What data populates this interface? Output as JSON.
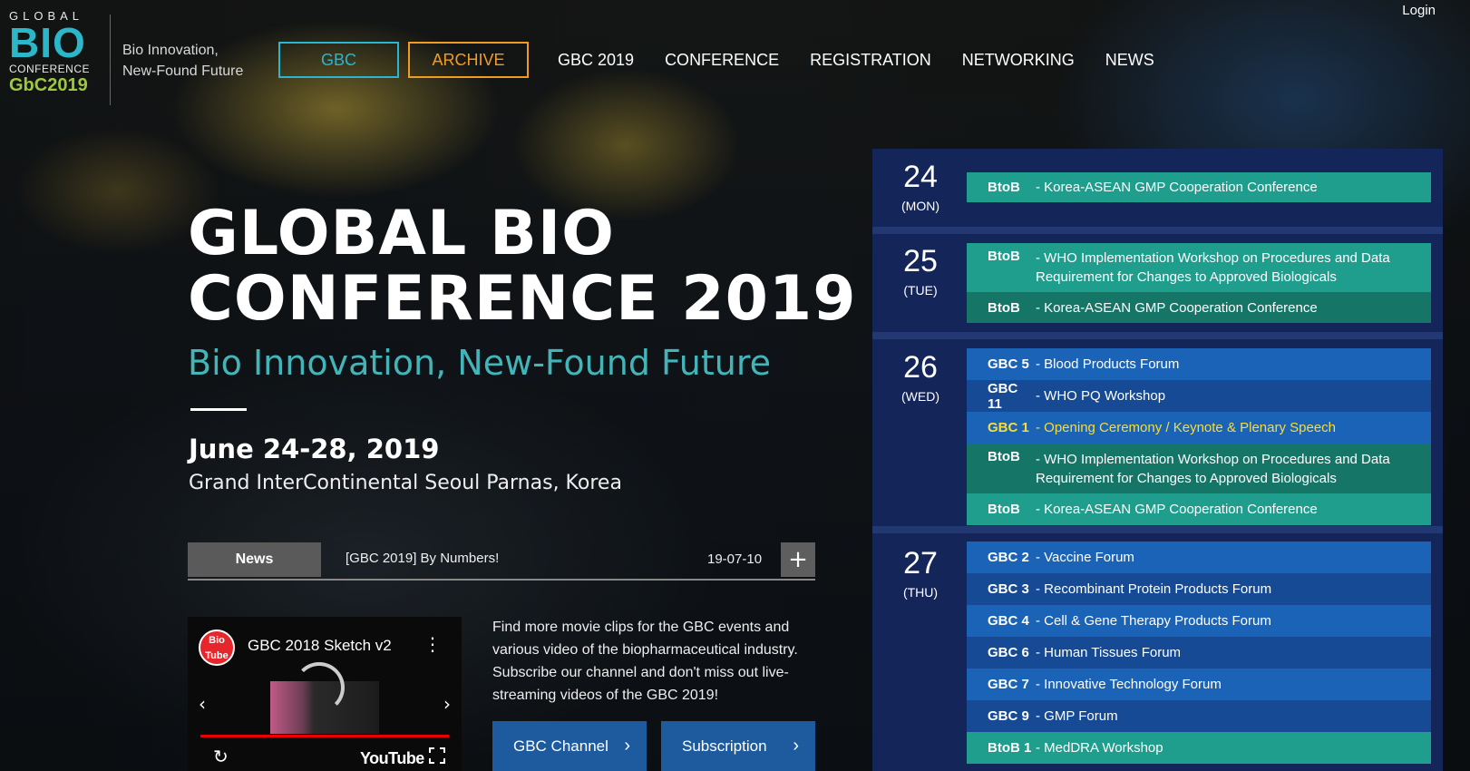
{
  "logo": {
    "global": "GLOBAL",
    "bio": "BIO",
    "conference": "CONFERENCE",
    "gbc": "GbC2019"
  },
  "tagline": {
    "line1": "Bio Innovation,",
    "line2": "New-Found Future"
  },
  "nav": {
    "gbc": "GBC",
    "archive": "ARCHIVE",
    "items": [
      "GBC 2019",
      "CONFERENCE",
      "REGISTRATION",
      "NETWORKING",
      "NEWS"
    ]
  },
  "login": "Login",
  "hero": {
    "title_line1": "GLOBAL BIO",
    "title_line2": "CONFERENCE 2019",
    "subtitle": "Bio Innovation, New-Found Future",
    "date": "June 24-28, 2019",
    "venue": "Grand InterContinental Seoul Parnas, Korea"
  },
  "news": {
    "label": "News",
    "title": "[GBC 2019] By Numbers!",
    "date": "19-07-10",
    "more": "+"
  },
  "video": {
    "channel_avatar": "Bio Tube",
    "title": "GBC 2018 Sketch v2",
    "logo": "YouTube",
    "description": "Find more movie clips for the GBC events and various video of the biopharmaceutical industry. Subscribe our channel and don't miss out live-streaming videos of the GBC 2019!"
  },
  "cta": {
    "channel": "GBC Channel",
    "subscription": "Subscription"
  },
  "schedule": [
    {
      "day": "24",
      "weekday": "(MON)",
      "events": [
        {
          "code": "BtoB",
          "title": "- Korea-ASEAN GMP Cooperation Conference",
          "style": "teal"
        }
      ]
    },
    {
      "day": "25",
      "weekday": "(TUE)",
      "events": [
        {
          "code": "BtoB",
          "title": "- WHO Implementation Workshop on Procedures and Data Requirement for Changes to Approved Biologicals",
          "style": "teal"
        },
        {
          "code": "BtoB",
          "title": "- Korea-ASEAN GMP Cooperation Conference",
          "style": "teal-d"
        }
      ]
    },
    {
      "day": "26",
      "weekday": "(WED)",
      "events": [
        {
          "code": "GBC 5",
          "title": "- Blood Products Forum",
          "style": "blue"
        },
        {
          "code": "GBC 11",
          "title": "- WHO PQ Workshop",
          "style": "blue-d"
        },
        {
          "code": "GBC 1",
          "title": "- Opening Ceremony / Keynote & Plenary Speech",
          "style": "blue hl"
        },
        {
          "code": "BtoB",
          "title": "- WHO Implementation Workshop on Procedures and Data Requirement for Changes to Approved Biologicals",
          "style": "teal-d"
        },
        {
          "code": "BtoB",
          "title": "- Korea-ASEAN GMP Cooperation Conference",
          "style": "teal"
        }
      ]
    },
    {
      "day": "27",
      "weekday": "(THU)",
      "events": [
        {
          "code": "GBC 2",
          "title": "- Vaccine Forum",
          "style": "blue"
        },
        {
          "code": "GBC 3",
          "title": "- Recombinant Protein Products Forum",
          "style": "blue-d"
        },
        {
          "code": "GBC 4",
          "title": "- Cell & Gene Therapy Products Forum",
          "style": "blue"
        },
        {
          "code": "GBC 6",
          "title": "- Human Tissues Forum",
          "style": "blue-d"
        },
        {
          "code": "GBC 7",
          "title": "- Innovative Technology Forum",
          "style": "blue"
        },
        {
          "code": "GBC 9",
          "title": "- GMP Forum",
          "style": "blue-d"
        },
        {
          "code": "BtoB 1",
          "title": "- MedDRA Workshop",
          "style": "teal"
        }
      ]
    }
  ],
  "colors": {
    "accent_teal": "#29b6d1",
    "accent_orange": "#f29b21",
    "subtitle_teal": "#43b5b8",
    "schedule_bg": "#14255a",
    "highlight_yellow": "#f6dd3a"
  }
}
